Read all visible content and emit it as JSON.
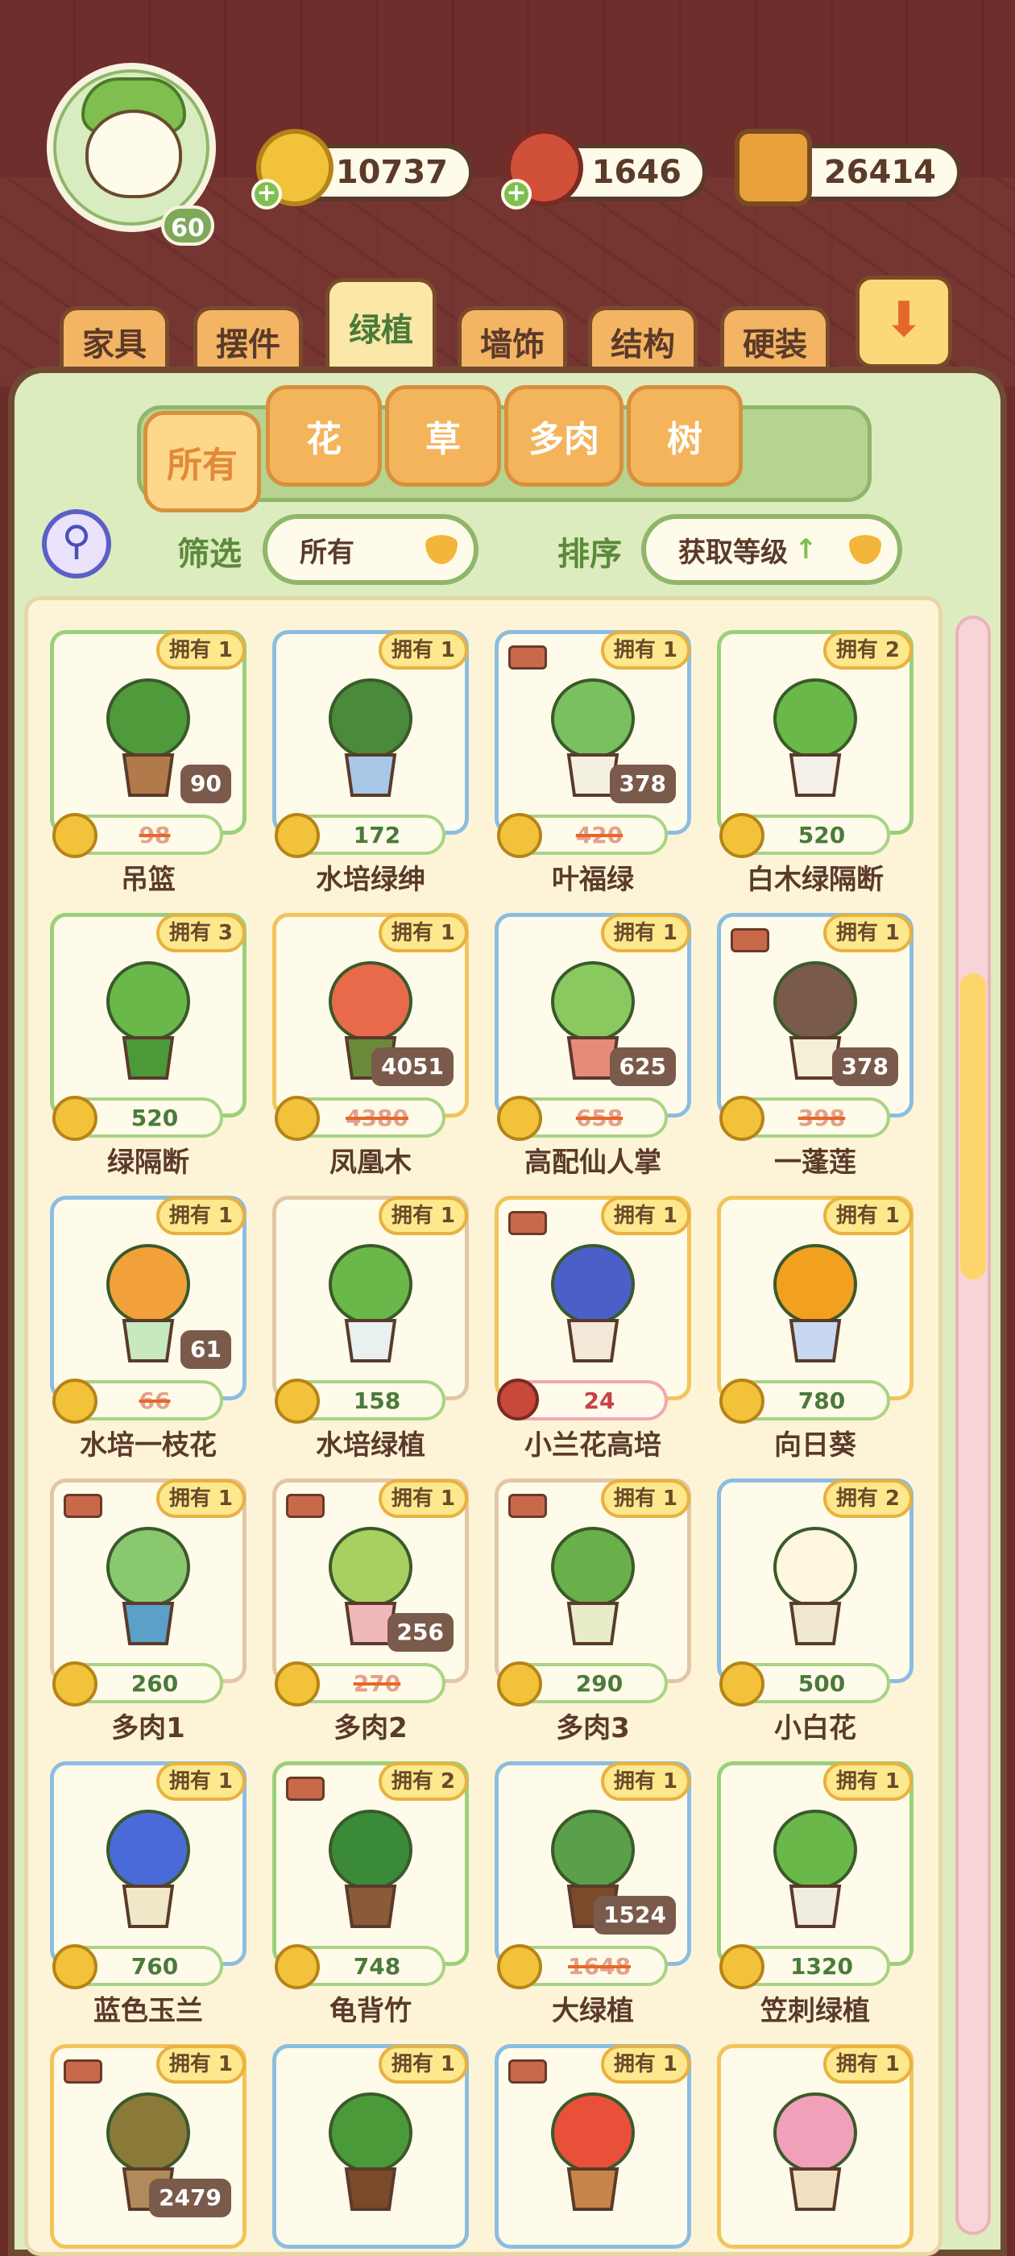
{
  "header": {
    "level": "60",
    "coins": "10737",
    "fruits": "1646",
    "books": "26414",
    "plus_symbol": "+"
  },
  "category_tabs": [
    {
      "label": "家具",
      "active": false
    },
    {
      "label": "摆件",
      "active": false
    },
    {
      "label": "绿植",
      "active": true
    },
    {
      "label": "墙饰",
      "active": false
    },
    {
      "label": "结构",
      "active": false
    },
    {
      "label": "硬装",
      "active": false
    }
  ],
  "sub_tabs": [
    {
      "label": "所有",
      "active": true
    },
    {
      "label": "花",
      "active": false
    },
    {
      "label": "草",
      "active": false
    },
    {
      "label": "多肉",
      "active": false
    },
    {
      "label": "树",
      "active": false
    }
  ],
  "filter": {
    "label": "筛选",
    "value": "所有"
  },
  "sort": {
    "label": "排序",
    "value": "获取等级",
    "arrow": "↑"
  },
  "items": [
    {
      "name": "吊篮",
      "owned": "拥有 1",
      "price": "98",
      "discount": "90",
      "border": "green",
      "truck": false,
      "currency": "coin",
      "plant_color": "#4f9a3a",
      "pot_color": "#b07a4a"
    },
    {
      "name": "水培绿绅",
      "owned": "拥有 1",
      "price": "172",
      "discount": "",
      "border": "blue",
      "truck": false,
      "currency": "coin",
      "plant_color": "#4a8a3a",
      "pot_color": "#a8c8e8"
    },
    {
      "name": "叶福绿",
      "owned": "拥有 1",
      "price": "420",
      "discount": "378",
      "border": "blue",
      "truck": true,
      "currency": "coin",
      "plant_color": "#7ac060",
      "pot_color": "#f4f0e0"
    },
    {
      "name": "白木绿隔断",
      "owned": "拥有 2",
      "price": "520",
      "discount": "",
      "border": "green",
      "truck": false,
      "currency": "coin",
      "plant_color": "#6ab84a",
      "pot_color": "#f4f0e8"
    },
    {
      "name": "绿隔断",
      "owned": "拥有 3",
      "price": "520",
      "discount": "",
      "border": "green",
      "truck": false,
      "currency": "coin",
      "plant_color": "#6ab84a",
      "pot_color": "#4a9a3a"
    },
    {
      "name": "凤凰木",
      "owned": "拥有 1",
      "price": "4380",
      "discount": "4051",
      "border": "gold",
      "truck": false,
      "currency": "coin",
      "plant_color": "#e86a4a",
      "pot_color": "#6a8a3a"
    },
    {
      "name": "高配仙人掌",
      "owned": "拥有 1",
      "price": "658",
      "discount": "625",
      "border": "blue",
      "truck": false,
      "currency": "coin",
      "plant_color": "#8ac860",
      "pot_color": "#e88a7a"
    },
    {
      "name": "一蓬莲",
      "owned": "拥有 1",
      "price": "398",
      "discount": "378",
      "border": "blue",
      "truck": true,
      "currency": "coin",
      "plant_color": "#7a5a4a",
      "pot_color": "#f4f0d8"
    },
    {
      "name": "水培一枝花",
      "owned": "拥有 1",
      "price": "66",
      "discount": "61",
      "border": "blue",
      "truck": false,
      "currency": "coin",
      "plant_color": "#f2a03a",
      "pot_color": "#c8e8c0"
    },
    {
      "name": "水培绿植",
      "owned": "拥有 1",
      "price": "158",
      "discount": "",
      "border": "tan",
      "truck": false,
      "currency": "coin",
      "plant_color": "#6ab84a",
      "pot_color": "#e8f0f0"
    },
    {
      "name": "小兰花高培",
      "owned": "拥有 1",
      "price": "24",
      "discount": "",
      "border": "gold",
      "truck": true,
      "currency": "cherry",
      "plant_color": "#4a60c8",
      "pot_color": "#f4e8d8"
    },
    {
      "name": "向日葵",
      "owned": "拥有 1",
      "price": "780",
      "discount": "",
      "border": "gold",
      "truck": false,
      "currency": "coin",
      "plant_color": "#f2a020",
      "pot_color": "#c8d8f0"
    },
    {
      "name": "多肉1",
      "owned": "拥有 1",
      "price": "260",
      "discount": "",
      "border": "tan",
      "truck": true,
      "currency": "coin",
      "plant_color": "#8ac870",
      "pot_color": "#5aa0c8"
    },
    {
      "name": "多肉2",
      "owned": "拥有 1",
      "price": "270",
      "discount": "256",
      "border": "tan",
      "truck": true,
      "currency": "coin",
      "plant_color": "#a8d060",
      "pot_color": "#f0b8b8"
    },
    {
      "name": "多肉3",
      "owned": "拥有 1",
      "price": "290",
      "discount": "",
      "border": "tan",
      "truck": true,
      "currency": "coin",
      "plant_color": "#6ab04a",
      "pot_color": "#e8ecc8"
    },
    {
      "name": "小白花",
      "owned": "拥有 2",
      "price": "500",
      "discount": "",
      "border": "blue",
      "truck": false,
      "currency": "coin",
      "plant_color": "#fff6e0",
      "pot_color": "#f0e8d0"
    },
    {
      "name": "蓝色玉兰",
      "owned": "拥有 1",
      "price": "760",
      "discount": "",
      "border": "blue",
      "truck": false,
      "currency": "coin",
      "plant_color": "#4a6ad8",
      "pot_color": "#f0e8c8"
    },
    {
      "name": "龟背竹",
      "owned": "拥有 2",
      "price": "748",
      "discount": "",
      "border": "green",
      "truck": true,
      "currency": "coin",
      "plant_color": "#3a8a3a",
      "pot_color": "#8a5a3a"
    },
    {
      "name": "大绿植",
      "owned": "拥有 1",
      "price": "1648",
      "discount": "1524",
      "border": "blue",
      "truck": false,
      "currency": "coin",
      "plant_color": "#5aa04a",
      "pot_color": "#7a4a2a"
    },
    {
      "name": "笠刺绿植",
      "owned": "拥有 1",
      "price": "1320",
      "discount": "",
      "border": "green",
      "truck": false,
      "currency": "coin",
      "plant_color": "#6ab84a",
      "pot_color": "#f0ece0"
    },
    {
      "name": "",
      "owned": "拥有 1",
      "price": "",
      "discount": "2479",
      "border": "gold",
      "truck": true,
      "currency": "none",
      "plant_color": "#8a7a3a",
      "pot_color": "#b08a5a"
    },
    {
      "name": "",
      "owned": "拥有 1",
      "price": "",
      "discount": "",
      "border": "blue",
      "truck": false,
      "currency": "none",
      "plant_color": "#4a9a3a",
      "pot_color": "#7a4a2a"
    },
    {
      "name": "",
      "owned": "拥有 1",
      "price": "",
      "discount": "",
      "border": "blue",
      "truck": true,
      "currency": "none",
      "plant_color": "#e8503a",
      "pot_color": "#c8844a"
    },
    {
      "name": "",
      "owned": "拥有 1",
      "price": "",
      "discount": "",
      "border": "gold",
      "truck": false,
      "currency": "none",
      "plant_color": "#f0a0b8",
      "pot_color": "#f0e0c0"
    }
  ]
}
